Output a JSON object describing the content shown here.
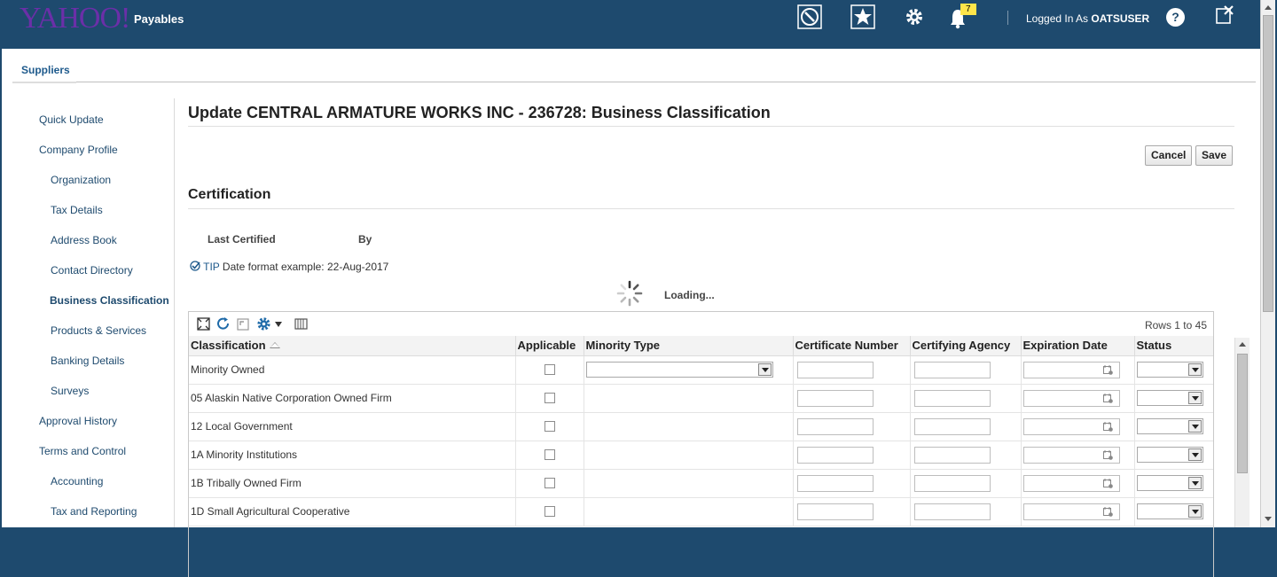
{
  "header": {
    "logo": "YAHOO!",
    "app_title": "Payables",
    "notification_count": "7",
    "logged_in_prefix": "Logged In As",
    "username": "OATSUSER",
    "help_label": "?"
  },
  "tabs": {
    "suppliers": "Suppliers"
  },
  "nav": {
    "items": [
      {
        "label": "Quick Update",
        "level": 1
      },
      {
        "label": "Company Profile",
        "level": 1
      },
      {
        "label": "Organization",
        "level": 2
      },
      {
        "label": "Tax Details",
        "level": 2
      },
      {
        "label": "Address Book",
        "level": 2
      },
      {
        "label": "Contact Directory",
        "level": 2
      },
      {
        "label": "Business Classification",
        "level": 2,
        "selected": true
      },
      {
        "label": "Products & Services",
        "level": 2
      },
      {
        "label": "Banking Details",
        "level": 2
      },
      {
        "label": "Surveys",
        "level": 2
      },
      {
        "label": "Approval History",
        "level": 1
      },
      {
        "label": "Terms and Control",
        "level": 1
      },
      {
        "label": "Accounting",
        "level": 2
      },
      {
        "label": "Tax and Reporting",
        "level": 2
      }
    ]
  },
  "page": {
    "title": "Update CENTRAL ARMATURE WORKS INC - 236728: Business Classification",
    "cancel_label": "Cancel",
    "save_label": "Save",
    "section_title": "Certification",
    "last_certified_label": "Last Certified",
    "by_label": "By",
    "tip_label": "TIP",
    "tip_text": "Date format example: 22-Aug-2017",
    "loading_text": "Loading..."
  },
  "table": {
    "rows_info": "Rows 1 to 45",
    "columns": [
      "Classification",
      "Applicable",
      "Minority Type",
      "Certificate Number",
      "Certifying Agency",
      "Expiration Date",
      "Status"
    ],
    "rows": [
      {
        "classification": "Minority Owned",
        "has_minority_select": true
      },
      {
        "classification": "05 Alaskin Native Corporation Owned Firm",
        "has_minority_select": false
      },
      {
        "classification": "12 Local Government",
        "has_minority_select": false
      },
      {
        "classification": "1A Minority Institutions",
        "has_minority_select": false
      },
      {
        "classification": "1B Tribally Owned Firm",
        "has_minority_select": false
      },
      {
        "classification": "1D Small Agricultural Cooperative",
        "has_minority_select": false
      }
    ]
  },
  "colors": {
    "header_bg": "#1e4a6e",
    "link_blue": "#1e4a6e",
    "badge_yellow": "#ffe54a",
    "logo_purple": "#6b2fa8"
  }
}
